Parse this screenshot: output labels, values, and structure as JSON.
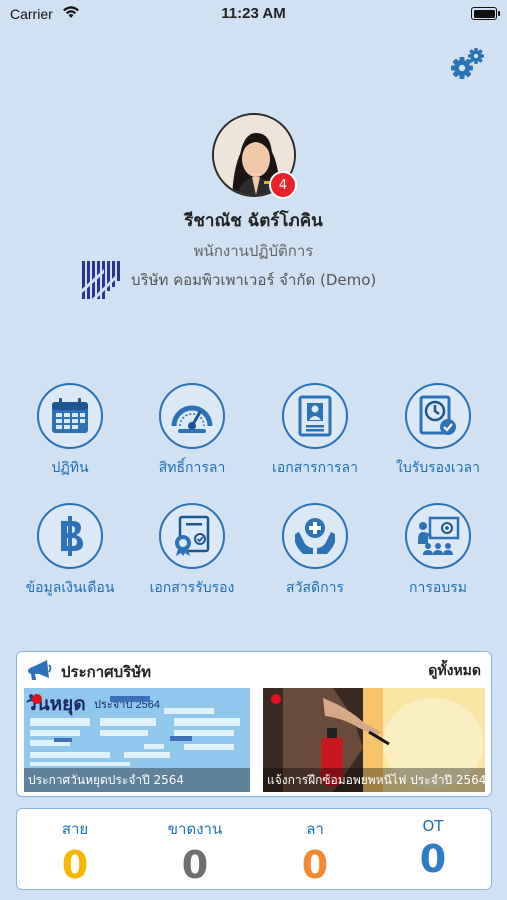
{
  "status_bar": {
    "carrier": "Carrier",
    "time": "11:23 AM"
  },
  "profile": {
    "name": "รีชาณัช  ฉัตร์โภคิน",
    "position": "พนักงานปฏิบัติการ",
    "company": "บริษัท คอมพิวเพาเวอร์ จำกัด (Demo)",
    "notification_count": "4"
  },
  "menu": [
    {
      "label": "ปฏิทิน",
      "icon": "calendar-icon"
    },
    {
      "label": "สิทธิ์การลา",
      "icon": "gauge-icon"
    },
    {
      "label": "เอกสารการลา",
      "icon": "leave-document-icon"
    },
    {
      "label": "ใบรับรองเวลา",
      "icon": "time-certificate-icon"
    },
    {
      "label": "ข้อมูลเงินเดือน",
      "icon": "baht-icon"
    },
    {
      "label": "เอกสารรับรอง",
      "icon": "certificate-icon"
    },
    {
      "label": "สวัสดิการ",
      "icon": "welfare-icon"
    },
    {
      "label": "การอบรม",
      "icon": "training-icon"
    }
  ],
  "announcements": {
    "title": "ประกาศบริษัท",
    "view_all": "ดูทั้งหมด",
    "items": [
      {
        "caption": "ประกาศวันหยุดประจำปี 2564",
        "image_heading": "วันหยุด",
        "image_subheading": "ประจำปี 2564"
      },
      {
        "caption": "แจ้งการฝึกซ้อมอพยพหนีไฟ  ประจำปี 2564"
      }
    ]
  },
  "summary": [
    {
      "label": "สาย",
      "value": "0",
      "color": "#f5b800"
    },
    {
      "label": "ขาดงาน",
      "value": "0",
      "color": "#6e6e6e"
    },
    {
      "label": "ลา",
      "value": "0",
      "color": "#f08a34"
    },
    {
      "label": "OT",
      "value": "0",
      "color": "#2f7cc7"
    }
  ],
  "colors": {
    "accent": "#1f6fb5",
    "background": "#cfe1f3",
    "badge": "#e8212b"
  }
}
